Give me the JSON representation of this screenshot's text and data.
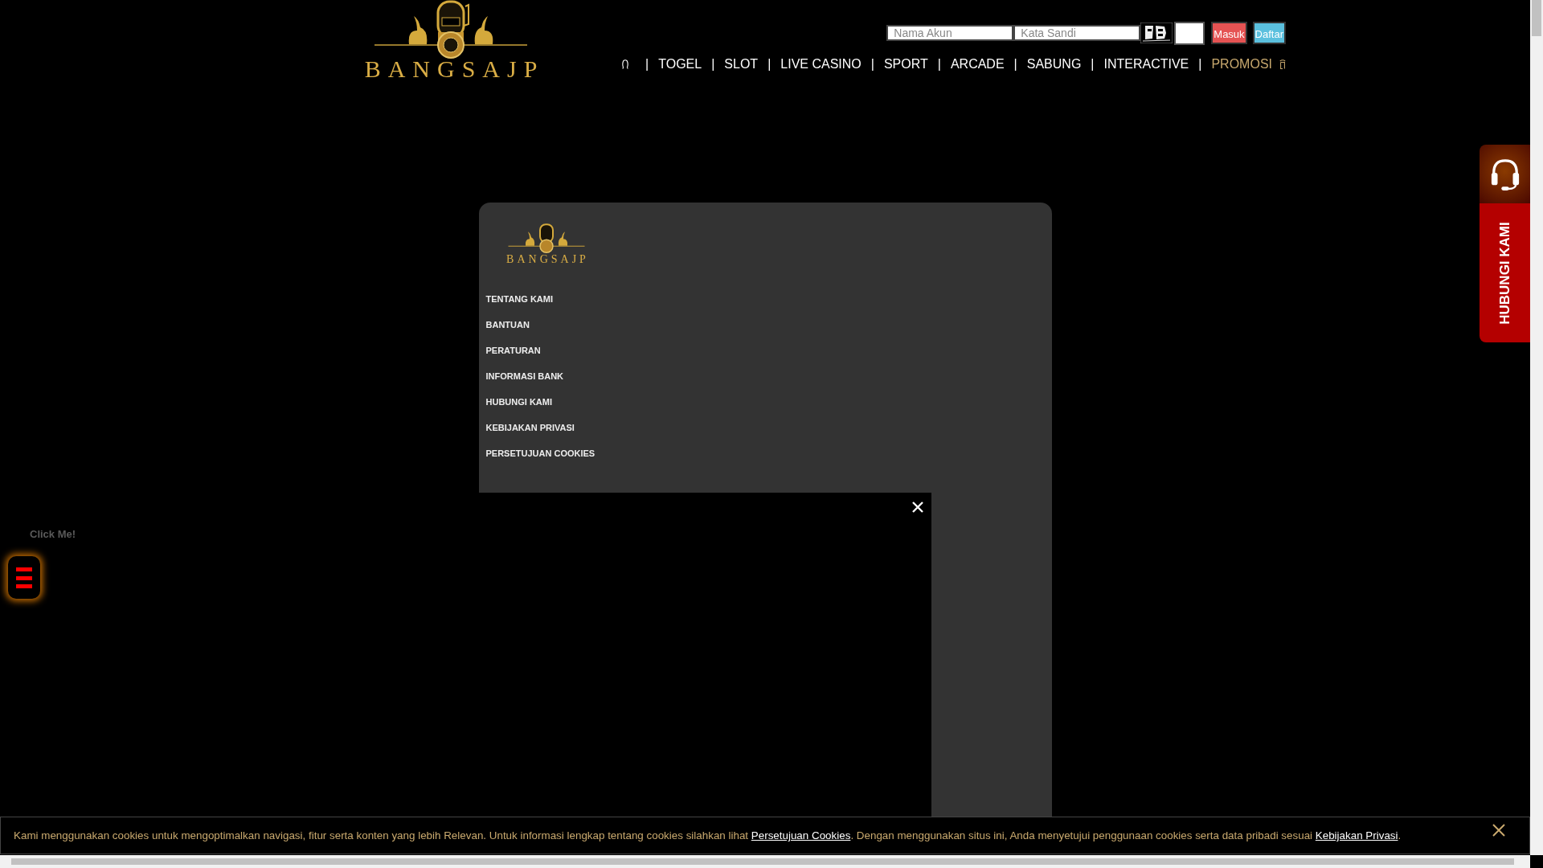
{
  "header": {
    "logo_text": "BANGSAJP",
    "login": {
      "username_placeholder": "Nama Akun",
      "password_placeholder": "Kata Sandi",
      "buttons": [
        {
          "label": "Masuk",
          "kind": "login"
        },
        {
          "label": "Daftar",
          "kind": "register"
        }
      ]
    },
    "nav": [
      {
        "separator": "|",
        "label": "TOGEL",
        "selected": false
      },
      {
        "separator": "|",
        "label": "SLOT",
        "selected": false
      },
      {
        "separator": "|",
        "label": "LIVE CASINO",
        "selected": false
      },
      {
        "separator": "|",
        "label": "SPORT",
        "selected": false
      },
      {
        "separator": "|",
        "label": "ARCADE",
        "selected": false
      },
      {
        "separator": "|",
        "label": "SABUNG",
        "selected": false
      },
      {
        "separator": "|",
        "label": "INTERACTIVE",
        "selected": false
      },
      {
        "separator": "|",
        "label": "PROMOSI",
        "selected": true
      }
    ]
  },
  "footer_panel": {
    "logo_text": "BANGSAJP",
    "items": [
      "TENTANG KAMI",
      "BANTUAN",
      "PERATURAN",
      "INFORMASI BANK",
      "HUBUNGI KAMI",
      "KEBIJAKAN PRIVASI",
      "PERSETUJUAN COOKIES"
    ]
  },
  "side_button": {
    "label": "Click Me!"
  },
  "contact_tab": {
    "label": "HUBUNGI KAMI"
  },
  "cookie_notice": {
    "parts": [
      {
        "kind": "text",
        "text": "Kami menggunakan cookies untuk mengoptimalkan navigasi, fitur serta konten yang lebih Relevan. Untuk informasi lengkap tentang cookies silahkan lihat "
      },
      {
        "kind": "link",
        "text": "Persetujuan Cookies"
      },
      {
        "kind": "text",
        "text": ". Dengan menggunakan situs ini, Anda menyetujui penggunaan cookies serta data pribadi sesuai "
      },
      {
        "kind": "link",
        "text": "Kebijakan Privasi"
      },
      {
        "kind": "text",
        "text": "."
      }
    ]
  }
}
